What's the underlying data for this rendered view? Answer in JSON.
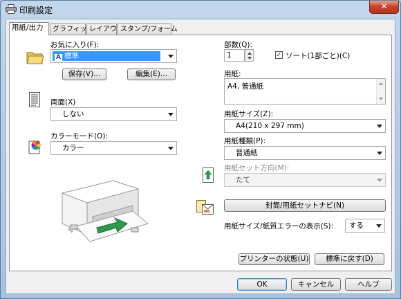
{
  "window": {
    "title": "印刷設定",
    "close_label": "✕"
  },
  "tabs": [
    {
      "label": "用紙/出力"
    },
    {
      "label": "グラフィックス"
    },
    {
      "label": "レイアウト"
    },
    {
      "label": "スタンプ/フォーム"
    }
  ],
  "left": {
    "favorites": {
      "label": "お気に入り(F):",
      "value": "標準",
      "value_icon": "A",
      "save_label": "保存(V)...",
      "edit_label": "編集(E)..."
    },
    "duplex": {
      "label": "両面(X)",
      "value": "しない"
    },
    "color_mode": {
      "label": "カラーモード(O):",
      "value": "カラー"
    }
  },
  "right": {
    "copies": {
      "label": "部数(Q):",
      "value": "1"
    },
    "collate": {
      "label": "ソート(1部ごと)(C)",
      "checked": true
    },
    "paper": {
      "label": "用紙:",
      "summary": "A4, 普通紙"
    },
    "paper_size": {
      "label": "用紙サイズ(Z):",
      "value": "A4(210 x 297 mm)"
    },
    "paper_type": {
      "label": "用紙種類(P):",
      "value": "普通紙"
    },
    "paper_orientation": {
      "label": "用紙セット方向(M):",
      "value": "たて"
    },
    "envelope_button": "封筒/用紙セットナビ(N)",
    "error_display": {
      "label": "用紙サイズ/紙質エラーの表示(S):",
      "value": "する"
    },
    "printer_status_button": "プリンターの状態(U)",
    "restore_defaults_button": "標準に戻す(D)"
  },
  "footer": {
    "ok": "OK",
    "cancel": "キャンセル",
    "help": "ヘルプ"
  },
  "colors": {
    "selection": "#3399ff",
    "arrow_green": "#2c9a4a",
    "frame": "#a9c2dd"
  }
}
